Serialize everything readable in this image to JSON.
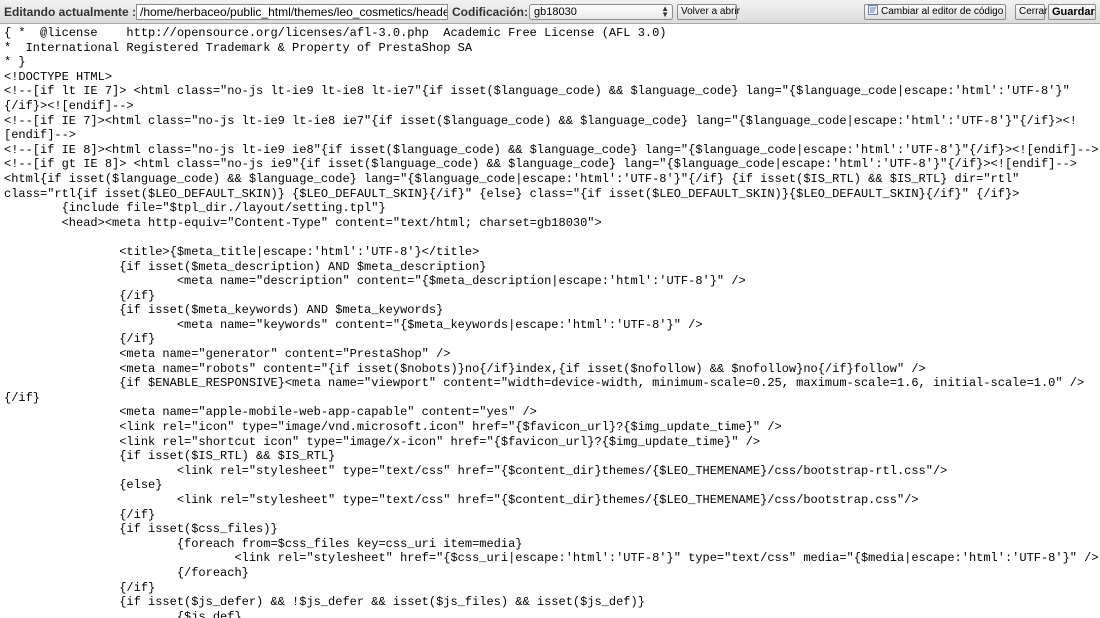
{
  "toolbar": {
    "editing_label": "Editando actualmente :",
    "file_path": "/home/herbaceo/public_html/themes/leo_cosmetics/header.tpl",
    "encoding_label": "Codificación:",
    "encoding_value": "gb18030",
    "reopen_button": "Volver a abrir",
    "switch_editor_button": "Cambiar al editor de código",
    "switch_editor_icon": "code-editor-icon",
    "close_button": "Cerrar",
    "save_button": "Guardar"
  },
  "code_lines": [
    "{ *  @license    http://opensource.org/licenses/afl-3.0.php  Academic Free License (AFL 3.0)",
    "*  International Registered Trademark & Property of PrestaShop SA",
    "* }",
    "<!DOCTYPE HTML>",
    "<!--[if lt IE 7]> <html class=\"no-js lt-ie9 lt-ie8 lt-ie7\"{if isset($language_code) && $language_code} lang=\"{$language_code|escape:'html':'UTF-8'}\"",
    "{/if}><![endif]-->",
    "<!--[if IE 7]><html class=\"no-js lt-ie9 lt-ie8 ie7\"{if isset($language_code) && $language_code} lang=\"{$language_code|escape:'html':'UTF-8'}\"{/if}><!",
    "[endif]-->",
    "<!--[if IE 8]><html class=\"no-js lt-ie9 ie8\"{if isset($language_code) && $language_code} lang=\"{$language_code|escape:'html':'UTF-8'}\"{/if}><![endif]-->",
    "<!--[if gt IE 8]> <html class=\"no-js ie9\"{if isset($language_code) && $language_code} lang=\"{$language_code|escape:'html':'UTF-8'}\"{/if}><![endif]-->",
    "<html{if isset($language_code) && $language_code} lang=\"{$language_code|escape:'html':'UTF-8'}\"{/if} {if isset($IS_RTL) && $IS_RTL} dir=\"rtl\"",
    "class=\"rtl{if isset($LEO_DEFAULT_SKIN)} {$LEO_DEFAULT_SKIN}{/if}\" {else} class=\"{if isset($LEO_DEFAULT_SKIN)}{$LEO_DEFAULT_SKIN}{/if}\" {/if}>",
    "        {include file=\"$tpl_dir./layout/setting.tpl\"}",
    "        <head><meta http-equiv=\"Content-Type\" content=\"text/html; charset=gb18030\">",
    "",
    "                <title>{$meta_title|escape:'html':'UTF-8'}</title>",
    "                {if isset($meta_description) AND $meta_description}",
    "                        <meta name=\"description\" content=\"{$meta_description|escape:'html':'UTF-8'}\" />",
    "                {/if}",
    "                {if isset($meta_keywords) AND $meta_keywords}",
    "                        <meta name=\"keywords\" content=\"{$meta_keywords|escape:'html':'UTF-8'}\" />",
    "                {/if}",
    "                <meta name=\"generator\" content=\"PrestaShop\" />",
    "                <meta name=\"robots\" content=\"{if isset($nobots)}no{/if}index,{if isset($nofollow) && $nofollow}no{/if}follow\" />",
    "                {if $ENABLE_RESPONSIVE}<meta name=\"viewport\" content=\"width=device-width, minimum-scale=0.25, maximum-scale=1.6, initial-scale=1.0\" />",
    "{/if}",
    "                <meta name=\"apple-mobile-web-app-capable\" content=\"yes\" />",
    "                <link rel=\"icon\" type=\"image/vnd.microsoft.icon\" href=\"{$favicon_url}?{$img_update_time}\" />",
    "                <link rel=\"shortcut icon\" type=\"image/x-icon\" href=\"{$favicon_url}?{$img_update_time}\" />",
    "                {if isset($IS_RTL) && $IS_RTL}",
    "                        <link rel=\"stylesheet\" type=\"text/css\" href=\"{$content_dir}themes/{$LEO_THEMENAME}/css/bootstrap-rtl.css\"/>",
    "                {else}",
    "                        <link rel=\"stylesheet\" type=\"text/css\" href=\"{$content_dir}themes/{$LEO_THEMENAME}/css/bootstrap.css\"/>",
    "                {/if}",
    "                {if isset($css_files)}",
    "                        {foreach from=$css_files key=css_uri item=media}",
    "                                <link rel=\"stylesheet\" href=\"{$css_uri|escape:'html':'UTF-8'}\" type=\"text/css\" media=\"{$media|escape:'html':'UTF-8'}\" />",
    "                        {/foreach}",
    "                {/if}",
    "                {if isset($js_defer) && !$js_defer && isset($js_files) && isset($js_def)}",
    "                        {$js_def}"
  ]
}
